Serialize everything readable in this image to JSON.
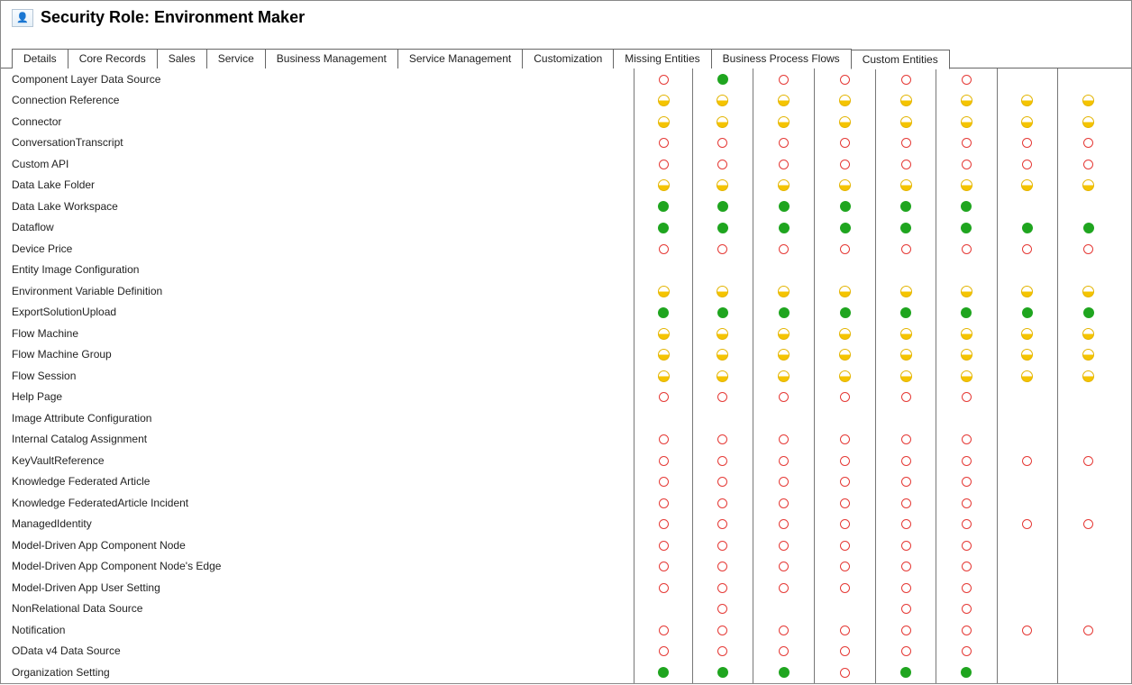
{
  "header": {
    "title": "Security Role: Environment Maker"
  },
  "tabs": [
    "Details",
    "Core Records",
    "Sales",
    "Service",
    "Business Management",
    "Service Management",
    "Customization",
    "Missing Entities",
    "Business Process Flows",
    "Custom Entities"
  ],
  "active_tab_index": 9,
  "perm_cols": 8,
  "entities": [
    {
      "name": "Component Layer Data Source",
      "perms": [
        "none",
        "org",
        "none",
        "none",
        "none",
        "none",
        "",
        ""
      ]
    },
    {
      "name": "Connection Reference",
      "perms": [
        "user",
        "user",
        "user",
        "user",
        "user",
        "user",
        "user",
        "user"
      ]
    },
    {
      "name": "Connector",
      "perms": [
        "user",
        "user",
        "user",
        "user",
        "user",
        "user",
        "user",
        "user"
      ]
    },
    {
      "name": "ConversationTranscript",
      "perms": [
        "none",
        "none",
        "none",
        "none",
        "none",
        "none",
        "none",
        "none"
      ]
    },
    {
      "name": "Custom API",
      "perms": [
        "none",
        "none",
        "none",
        "none",
        "none",
        "none",
        "none",
        "none"
      ]
    },
    {
      "name": "Data Lake Folder",
      "perms": [
        "user",
        "user",
        "user",
        "user",
        "user",
        "user",
        "user",
        "user"
      ]
    },
    {
      "name": "Data Lake Workspace",
      "perms": [
        "org",
        "org",
        "org",
        "org",
        "org",
        "org",
        "",
        ""
      ]
    },
    {
      "name": "Dataflow",
      "perms": [
        "org",
        "org",
        "org",
        "org",
        "org",
        "org",
        "org",
        "org"
      ]
    },
    {
      "name": "Device Price",
      "perms": [
        "none",
        "none",
        "none",
        "none",
        "none",
        "none",
        "none",
        "none"
      ]
    },
    {
      "name": "Entity Image Configuration",
      "perms": [
        "",
        "",
        "",
        "",
        "",
        "",
        "",
        ""
      ]
    },
    {
      "name": "Environment Variable Definition",
      "perms": [
        "user",
        "user",
        "user",
        "user",
        "user",
        "user",
        "user",
        "user"
      ]
    },
    {
      "name": "ExportSolutionUpload",
      "perms": [
        "org",
        "org",
        "org",
        "org",
        "org",
        "org",
        "org",
        "org"
      ]
    },
    {
      "name": "Flow Machine",
      "perms": [
        "user",
        "user",
        "user",
        "user",
        "user",
        "user",
        "user",
        "user"
      ]
    },
    {
      "name": "Flow Machine Group",
      "perms": [
        "user",
        "user",
        "user",
        "user",
        "user",
        "user",
        "user",
        "user"
      ]
    },
    {
      "name": "Flow Session",
      "perms": [
        "user",
        "user",
        "user",
        "user",
        "user",
        "user",
        "user",
        "user"
      ]
    },
    {
      "name": "Help Page",
      "perms": [
        "none",
        "none",
        "none",
        "none",
        "none",
        "none",
        "",
        ""
      ]
    },
    {
      "name": "Image Attribute Configuration",
      "perms": [
        "",
        "",
        "",
        "",
        "",
        "",
        "",
        ""
      ]
    },
    {
      "name": "Internal Catalog Assignment",
      "perms": [
        "none",
        "none",
        "none",
        "none",
        "none",
        "none",
        "",
        ""
      ]
    },
    {
      "name": "KeyVaultReference",
      "perms": [
        "none",
        "none",
        "none",
        "none",
        "none",
        "none",
        "none",
        "none"
      ]
    },
    {
      "name": "Knowledge Federated Article",
      "perms": [
        "none",
        "none",
        "none",
        "none",
        "none",
        "none",
        "",
        ""
      ]
    },
    {
      "name": "Knowledge FederatedArticle Incident",
      "perms": [
        "none",
        "none",
        "none",
        "none",
        "none",
        "none",
        "",
        ""
      ]
    },
    {
      "name": "ManagedIdentity",
      "perms": [
        "none",
        "none",
        "none",
        "none",
        "none",
        "none",
        "none",
        "none"
      ]
    },
    {
      "name": "Model-Driven App Component Node",
      "perms": [
        "none",
        "none",
        "none",
        "none",
        "none",
        "none",
        "",
        ""
      ]
    },
    {
      "name": "Model-Driven App Component Node's Edge",
      "perms": [
        "none",
        "none",
        "none",
        "none",
        "none",
        "none",
        "",
        ""
      ]
    },
    {
      "name": "Model-Driven App User Setting",
      "perms": [
        "none",
        "none",
        "none",
        "none",
        "none",
        "none",
        "",
        ""
      ]
    },
    {
      "name": "NonRelational Data Source",
      "perms": [
        "",
        "none",
        "",
        "",
        "none",
        "none",
        "",
        ""
      ]
    },
    {
      "name": "Notification",
      "perms": [
        "none",
        "none",
        "none",
        "none",
        "none",
        "none",
        "none",
        "none"
      ]
    },
    {
      "name": "OData v4 Data Source",
      "perms": [
        "none",
        "none",
        "none",
        "none",
        "none",
        "none",
        "",
        ""
      ]
    },
    {
      "name": "Organization Setting",
      "perms": [
        "org",
        "org",
        "org",
        "none",
        "org",
        "org",
        "",
        ""
      ]
    }
  ]
}
